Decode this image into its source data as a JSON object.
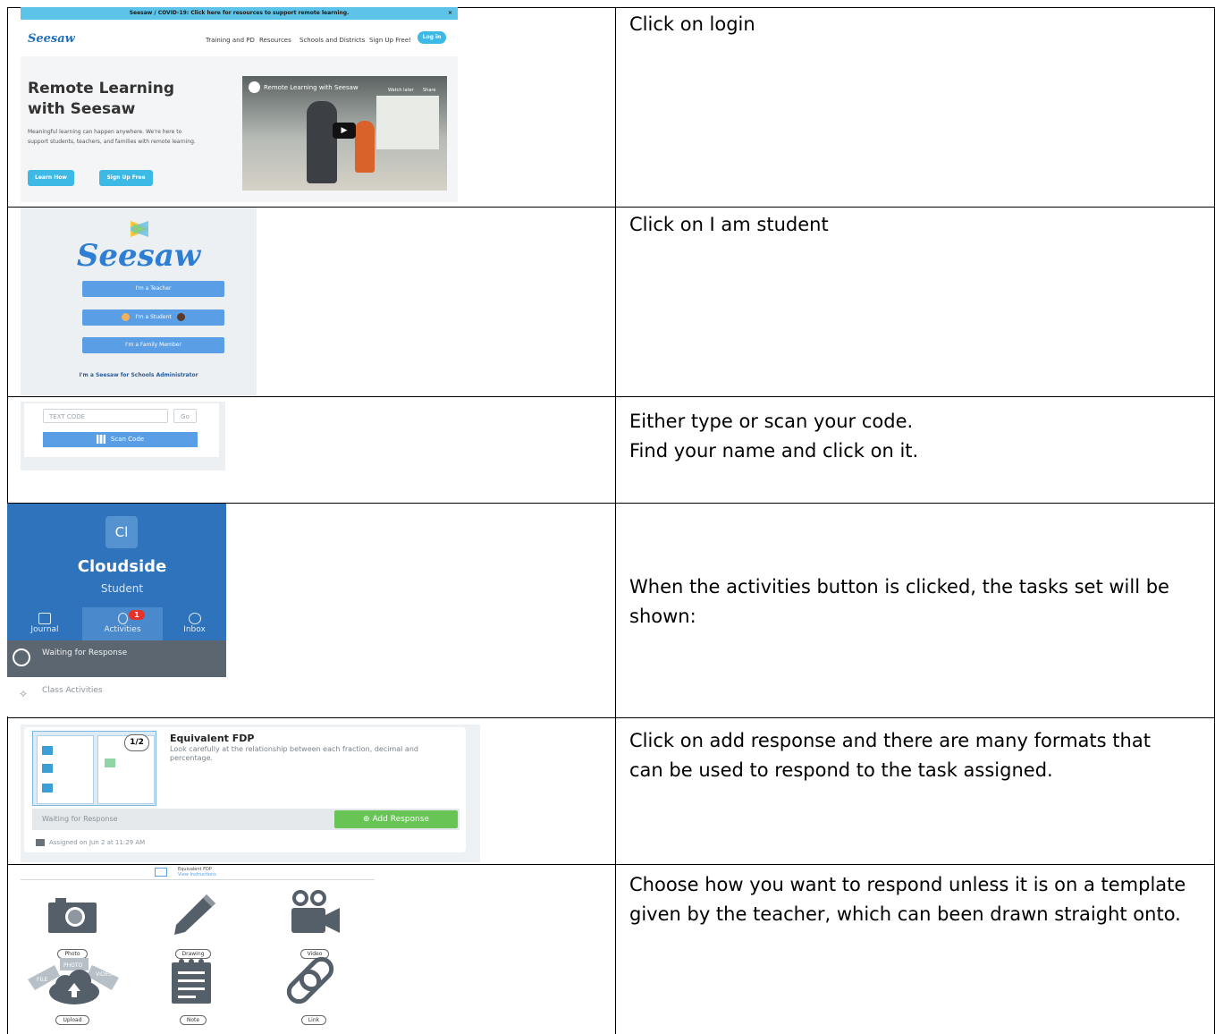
{
  "instructions": [
    "Click on login",
    "Click on I am student",
    "Either type or scan your code.",
    "Find your name and click on it.",
    "When the activities button is clicked, the tasks set will be shown:",
    "Click on add response and there are many formats that can be used to respond to the task assigned.",
    "Choose how you want to respond unless it is on a template given by the teacher, which can been drawn straight onto."
  ],
  "site": {
    "banner": "Seesaw / COVID-19: Click here for resources to support remote learning.",
    "banner_close": "×",
    "logo": "Seesaw",
    "nav": [
      "Training and PD",
      "Resources",
      "Schools and Districts",
      "Sign Up Free!"
    ],
    "login": "Log in",
    "headline_1": "Remote Learning",
    "headline_2": "with Seesaw",
    "description": "Meaningful learning can happen anywhere. We're here to support students, teachers, and families with remote learning.",
    "learn_how": "Learn How",
    "sign_up": "Sign Up Free",
    "video_title": "Remote Learning with Seesaw",
    "watch_later": "Watch later",
    "share": "Share"
  },
  "roles": {
    "wordmark": "Seesaw",
    "teacher": "I'm a Teacher",
    "student": "I'm a Student",
    "family": "I'm a Family Member",
    "admin": "I'm a Seesaw for Schools Administrator"
  },
  "code": {
    "placeholder": "TEXT CODE",
    "go": "Go",
    "scan": "Scan Code"
  },
  "profile": {
    "initials": "Cl",
    "name": "Cloudside",
    "role": "Student",
    "tabs": [
      "Journal",
      "Activities",
      "Inbox"
    ],
    "badge": "1",
    "waiting": "Waiting for Response",
    "class_activities": "Class Activities"
  },
  "activity": {
    "fraction": "1/2",
    "title": "Equivalent FDP",
    "description": "Look carefully at the relationship between each fraction, decimal and percentage.",
    "status": "Waiting for Response",
    "add_response": "Add Response",
    "assigned": "Assigned on Jun 2 at 11:29 AM"
  },
  "respond": {
    "title": "Equivalent FDP",
    "subtitle": "View Instructions",
    "options": [
      "Photo",
      "Drawing",
      "Video",
      "Upload",
      "Note",
      "Link"
    ],
    "upload_tags": [
      "FILE",
      "PHOTO",
      "VIDEO"
    ]
  },
  "colors": {
    "seesaw_blue": "#2e7fd3",
    "button_blue": "#5a9ee6",
    "banner_cyan": "#5dc3e8",
    "add_green": "#67c455",
    "badge_red": "#e5332a",
    "icon_gray": "#555f69"
  }
}
